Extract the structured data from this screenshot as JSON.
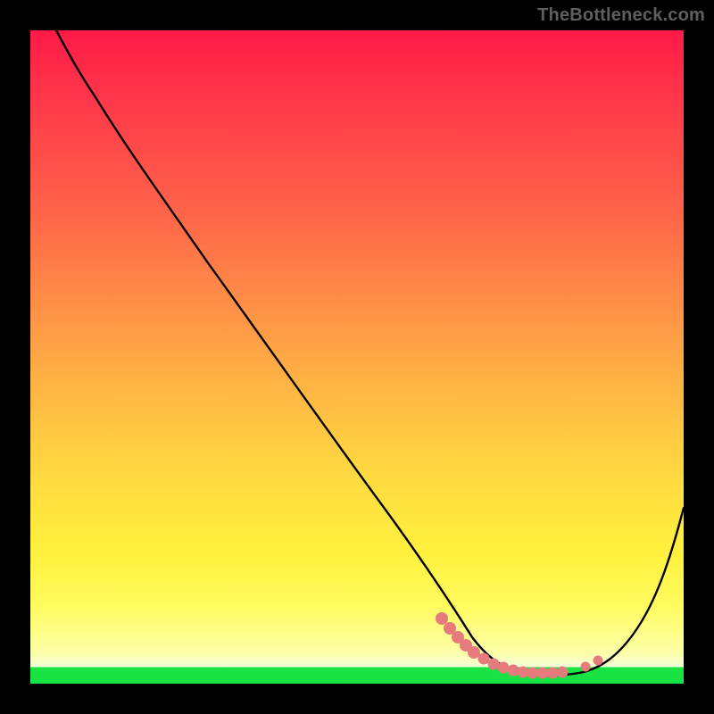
{
  "watermark": "TheBottleneck.com",
  "chart_data": {
    "type": "line",
    "title": "",
    "xlabel": "",
    "ylabel": "",
    "xlim": [
      0,
      100
    ],
    "ylim": [
      0,
      100
    ],
    "grid": false,
    "legend": false,
    "series": [
      {
        "name": "bottleneck-curve",
        "x": [
          4,
          7,
          10,
          14,
          20,
          27,
          35,
          43,
          50,
          57,
          62,
          66,
          69,
          72,
          75,
          78,
          81,
          84,
          88,
          92,
          96,
          100
        ],
        "values": [
          100,
          97,
          93.5,
          88,
          79,
          69,
          57,
          45,
          34.5,
          24,
          16,
          10,
          6,
          3.5,
          2,
          1.3,
          1,
          1.2,
          3,
          9,
          17,
          27
        ]
      }
    ],
    "highlight_points": {
      "name": "optimal-range-markers",
      "x": [
        63,
        65,
        67,
        68.5,
        70,
        71.5,
        73,
        74.5,
        76,
        77.5,
        79,
        80.5,
        82,
        85,
        87
      ],
      "values": [
        10,
        7.5,
        5.5,
        4.5,
        3.8,
        3.2,
        2.8,
        2.5,
        2.2,
        2.1,
        2.0,
        2.0,
        2.1,
        2.7,
        4.0
      ]
    },
    "background_gradient": {
      "top_color": "#ff1a47",
      "bottom_color": "#f6ffd8",
      "bottom_band_color": "#19e343"
    }
  }
}
